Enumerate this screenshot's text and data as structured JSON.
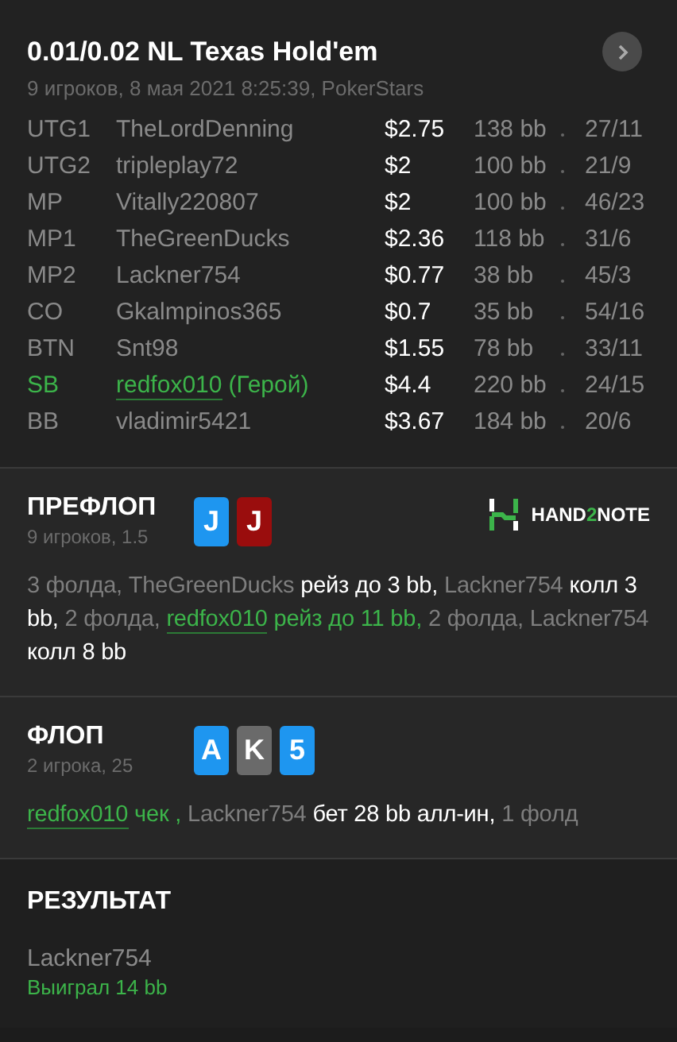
{
  "header": {
    "title": "0.01/0.02 NL Texas Hold'em",
    "subtitle": "9 игроков, 8 мая 2021 8:25:39, PokerStars"
  },
  "players": [
    {
      "position": "UTG1",
      "name": "TheLordDenning",
      "stack": "$2.75",
      "bb": "138 bb",
      "stats": "27/11",
      "hero": false
    },
    {
      "position": "UTG2",
      "name": "tripleplay72",
      "stack": "$2",
      "bb": "100 bb",
      "stats": "21/9",
      "hero": false
    },
    {
      "position": "MP",
      "name": "Vitally220807",
      "stack": "$2",
      "bb": "100 bb",
      "stats": "46/23",
      "hero": false
    },
    {
      "position": "MP1",
      "name": "TheGreenDucks",
      "stack": "$2.36",
      "bb": "118 bb",
      "stats": "31/6",
      "hero": false
    },
    {
      "position": "MP2",
      "name": "Lackner754",
      "stack": "$0.77",
      "bb": "38 bb",
      "stats": "45/3",
      "hero": false
    },
    {
      "position": "CO",
      "name": "Gkalmpinos365",
      "stack": "$0.7",
      "bb": "35 bb",
      "stats": "54/16",
      "hero": false
    },
    {
      "position": "BTN",
      "name": "Snt98",
      "stack": "$1.55",
      "bb": "78 bb",
      "stats": "33/11",
      "hero": false
    },
    {
      "position": "SB",
      "name": "redfox010",
      "hero_label": "(Герой)",
      "stack": "$4.4",
      "bb": "220 bb",
      "stats": "24/15",
      "hero": true
    },
    {
      "position": "BB",
      "name": "vladimir5421",
      "stack": "$3.67",
      "bb": "184 bb",
      "stats": "20/6",
      "hero": false
    }
  ],
  "streets": [
    {
      "title": "ПРЕФЛОП",
      "subtitle": "9 игроков, 1.5",
      "cards": [
        {
          "rank": "J",
          "color": "#1e96f0"
        },
        {
          "rank": "J",
          "color": "#9a0d0d"
        }
      ],
      "logo": [
        {
          "text": "HAND",
          "kind": "plain"
        },
        {
          "text": "2",
          "kind": "accent"
        },
        {
          "text": "NOTE",
          "kind": "plain"
        }
      ],
      "actions": [
        {
          "text": "3 фолда, TheGreenDucks ",
          "kind": "plain"
        },
        {
          "text": "рейз до 3 bb,",
          "kind": "action"
        },
        {
          "text": " Lackner754 ",
          "kind": "plain"
        },
        {
          "text": "колл 3 bb,",
          "kind": "action"
        },
        {
          "text": " 2 фолда, ",
          "kind": "plain"
        },
        {
          "text": "redfox010",
          "kind": "hero"
        },
        {
          "text": " рейз до 11 bb,",
          "kind": "hero-action"
        },
        {
          "text": " 2 фолда, Lackner754 ",
          "kind": "plain"
        },
        {
          "text": "колл 8 bb",
          "kind": "action"
        }
      ]
    },
    {
      "title": "ФЛОП",
      "subtitle": "2 игрока, 25",
      "cards": [
        {
          "rank": "A",
          "color": "#1e96f0"
        },
        {
          "rank": "K",
          "color": "#6a6a6a"
        },
        {
          "rank": "5",
          "color": "#1e96f0"
        }
      ],
      "actions": [
        {
          "text": "redfox010",
          "kind": "hero"
        },
        {
          "text": " чек ,",
          "kind": "hero-action"
        },
        {
          "text": " Lackner754 ",
          "kind": "plain"
        },
        {
          "text": "бет 28 bb алл-ин,",
          "kind": "action"
        },
        {
          "text": " 1 фолд",
          "kind": "plain"
        }
      ]
    }
  ],
  "result": {
    "title": "РЕЗУЛЬТАТ",
    "winner": "Lackner754",
    "outcome": "Выиграл 14 bb"
  }
}
